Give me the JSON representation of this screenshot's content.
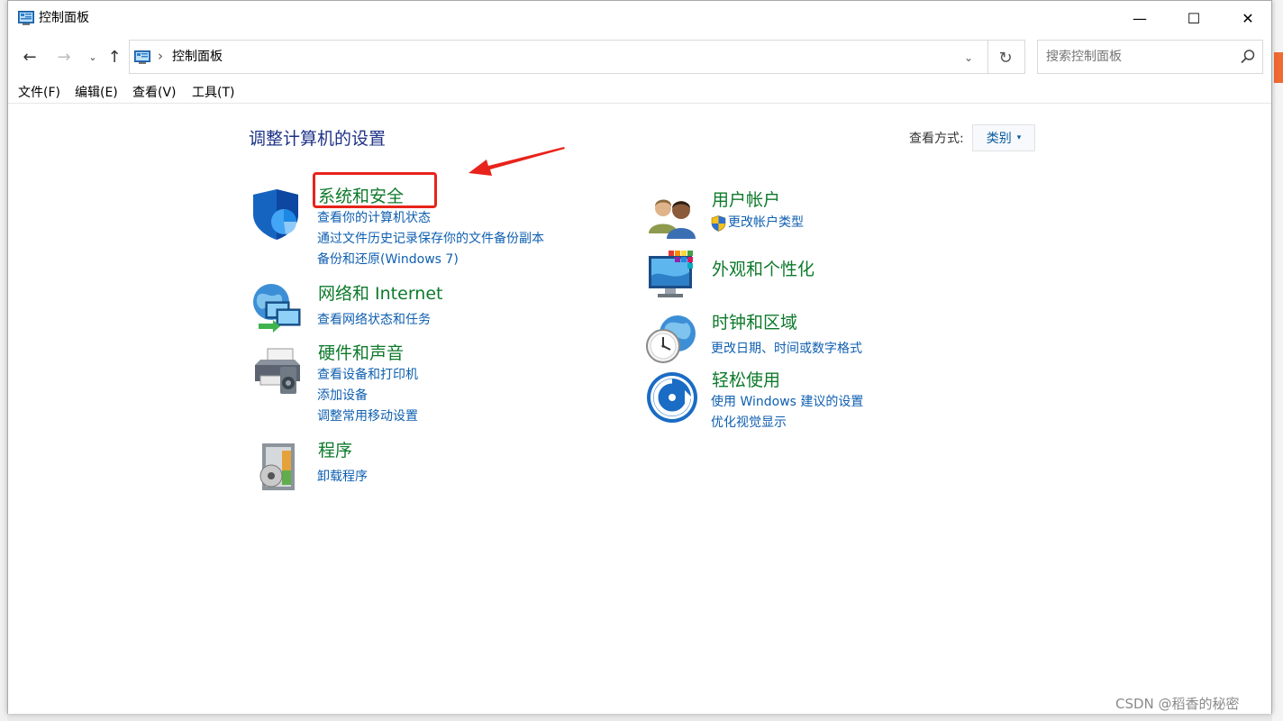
{
  "window": {
    "title": "控制面板",
    "minimize": "—",
    "maximize": "☐",
    "close": "✕"
  },
  "nav": {
    "back": "←",
    "forward": "→",
    "recent": "⌄",
    "up": "↑",
    "address_sep": "›",
    "address": "控制面板",
    "dropdown": "⌄",
    "refresh": "↻",
    "search_placeholder": "搜索控制面板"
  },
  "menu": {
    "file": "文件(F)",
    "edit": "编辑(E)",
    "view": "查看(V)",
    "tools": "工具(T)"
  },
  "main": {
    "heading": "调整计算机的设置",
    "viewby_label": "查看方式:",
    "viewby_value": "类别",
    "viewby_caret": "▾"
  },
  "categories": {
    "system": {
      "title": "系统和安全",
      "links": [
        "查看你的计算机状态",
        "通过文件历史记录保存你的文件备份副本",
        "备份和还原(Windows 7)"
      ]
    },
    "network": {
      "title": "网络和 Internet",
      "links": [
        "查看网络状态和任务"
      ]
    },
    "hardware": {
      "title": "硬件和声音",
      "links": [
        "查看设备和打印机",
        "添加设备",
        "调整常用移动设置"
      ]
    },
    "programs": {
      "title": "程序",
      "links": [
        "卸载程序"
      ]
    },
    "users": {
      "title": "用户帐户",
      "links": [
        "更改帐户类型"
      ]
    },
    "appearance": {
      "title": "外观和个性化",
      "links": []
    },
    "clock": {
      "title": "时钟和区域",
      "links": [
        "更改日期、时间或数字格式"
      ]
    },
    "ease": {
      "title": "轻松使用",
      "links": [
        "使用 Windows 建议的设置",
        "优化视觉显示"
      ]
    }
  },
  "watermark": "CSDN @稻香的秘密",
  "colors": {
    "category_title": "#0d7a2b",
    "link": "#0f5fb0",
    "heading": "#1e3287",
    "annotation": "#e8231b"
  }
}
